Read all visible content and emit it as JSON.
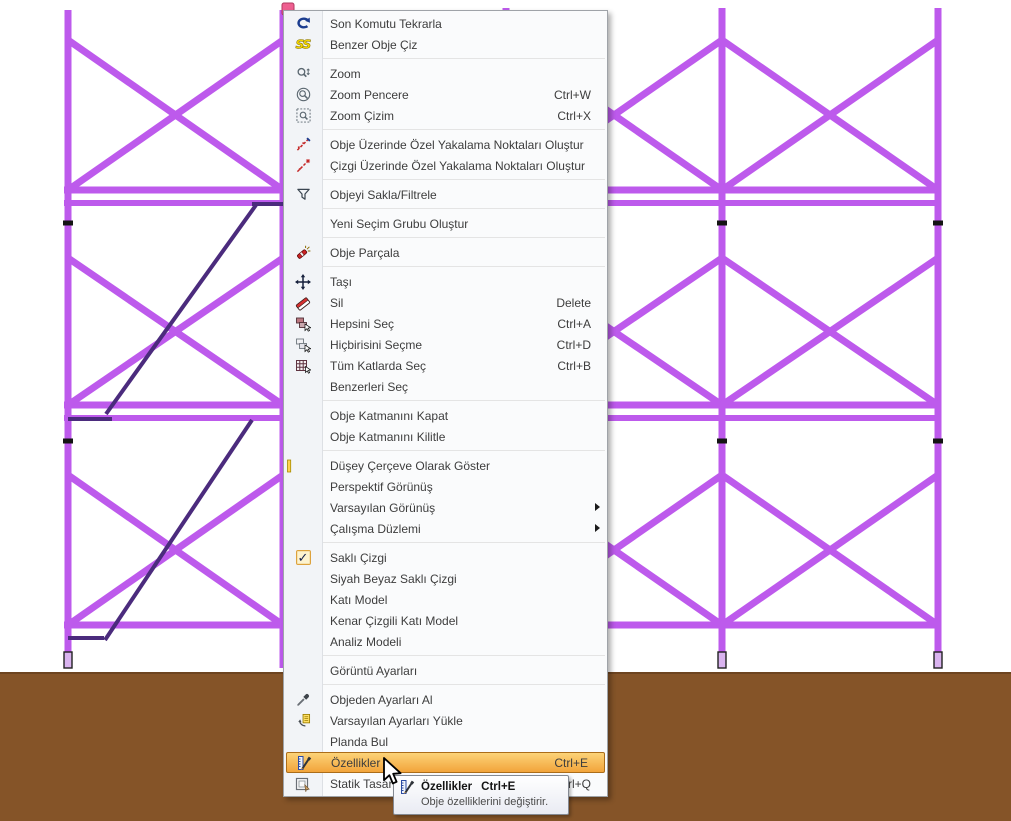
{
  "theme": {
    "scaffold_color": "#bd5aec",
    "stair_color": "#4b2b7d",
    "ground_color": "#855428",
    "selection_node_color": "#ee5f90",
    "menu_bg": "#fafbfc",
    "menu_border": "#9fa3a8",
    "gutter_bg": "#f2f4f7",
    "gutter_line": "#dde0e4",
    "separator_color": "#e4e4e4",
    "text_color": "#3d3d3d",
    "highlight_top": "#fcd378",
    "highlight_bottom": "#f2a43b",
    "highlight_border": "#ab6d19",
    "tooltip_border": "#848992",
    "tooltip_bg_top": "#ffffff",
    "tooltip_bg_bottom": "#e9ebf3"
  },
  "menu": {
    "items": [
      {
        "type": "item",
        "name": "repeat-last-command",
        "icon": "redo-icon",
        "label": "Son Komutu Tekrarla"
      },
      {
        "type": "item",
        "name": "draw-similar-object",
        "icon": "draw-similar-icon",
        "label": "Benzer Obje Çiz"
      },
      {
        "type": "sep"
      },
      {
        "type": "item",
        "name": "zoom",
        "icon": "zoom-icon",
        "label": "Zoom"
      },
      {
        "type": "item",
        "name": "zoom-window",
        "icon": "zoom-window-icon",
        "label": "Zoom Pencere",
        "shortcut": "Ctrl+W"
      },
      {
        "type": "item",
        "name": "zoom-drawing",
        "icon": "zoom-drawing-icon",
        "label": "Zoom Çizim",
        "shortcut": "Ctrl+X"
      },
      {
        "type": "sep"
      },
      {
        "type": "item",
        "name": "snap-points-on-object",
        "icon": "snap-object-icon",
        "label": "Obje Üzerinde Özel Yakalama Noktaları Oluştur"
      },
      {
        "type": "item",
        "name": "snap-points-on-line",
        "icon": "snap-line-icon",
        "label": "Çizgi Üzerinde Özel Yakalama Noktaları Oluştur"
      },
      {
        "type": "sep"
      },
      {
        "type": "item",
        "name": "hide-filter-object",
        "icon": "filter-icon",
        "label": "Objeyi Sakla/Filtrele"
      },
      {
        "type": "sep"
      },
      {
        "type": "item",
        "name": "new-selection-group",
        "label": "Yeni Seçim Grubu Oluştur"
      },
      {
        "type": "sep"
      },
      {
        "type": "item",
        "name": "explode-object",
        "icon": "explode-icon",
        "label": "Obje Parçala"
      },
      {
        "type": "sep"
      },
      {
        "type": "item",
        "name": "move",
        "icon": "move-icon",
        "label": "Taşı"
      },
      {
        "type": "item",
        "name": "delete",
        "icon": "erase-icon",
        "label": "Sil",
        "shortcut": "Delete"
      },
      {
        "type": "item",
        "name": "select-all",
        "icon": "select-all-icon",
        "label": "Hepsini Seç",
        "shortcut": "Ctrl+A"
      },
      {
        "type": "item",
        "name": "select-none",
        "icon": "select-none-icon",
        "label": "Hiçbirisini Seçme",
        "shortcut": "Ctrl+D"
      },
      {
        "type": "item",
        "name": "select-all-floors",
        "icon": "select-floors-icon",
        "label": "Tüm Katlarda Seç",
        "shortcut": "Ctrl+B"
      },
      {
        "type": "item",
        "name": "select-similar",
        "label": "Benzerleri Seç"
      },
      {
        "type": "sep"
      },
      {
        "type": "item",
        "name": "close-object-layer",
        "label": "Obje Katmanını Kapat"
      },
      {
        "type": "item",
        "name": "lock-object-layer",
        "label": "Obje Katmanını Kilitle"
      },
      {
        "type": "sep"
      },
      {
        "type": "item",
        "name": "show-vertical-frame",
        "icon": "vertical-frame-icon",
        "label": "Düşey Çerçeve Olarak Göster"
      },
      {
        "type": "item",
        "name": "perspective-view",
        "label": "Perspektif Görünüş"
      },
      {
        "type": "item",
        "name": "default-view",
        "label": "Varsayılan Görünüş",
        "submenu": true
      },
      {
        "type": "item",
        "name": "work-plane",
        "label": "Çalışma Düzlemi",
        "submenu": true
      },
      {
        "type": "sep"
      },
      {
        "type": "item",
        "name": "hidden-line",
        "checkbox": true,
        "label": "Saklı Çizgi"
      },
      {
        "type": "item",
        "name": "bw-hidden-line",
        "label": "Siyah Beyaz Saklı Çizgi"
      },
      {
        "type": "item",
        "name": "solid-model",
        "label": "Katı Model"
      },
      {
        "type": "item",
        "name": "solid-model-edges",
        "label": "Kenar Çizgili Katı Model"
      },
      {
        "type": "item",
        "name": "analysis-model",
        "label": "Analiz Modeli"
      },
      {
        "type": "sep"
      },
      {
        "type": "item",
        "name": "display-settings",
        "label": "Görüntü Ayarları"
      },
      {
        "type": "sep"
      },
      {
        "type": "item",
        "name": "get-settings-from-object",
        "icon": "eyedropper-icon",
        "label": "Objeden Ayarları Al"
      },
      {
        "type": "item",
        "name": "load-default-settings",
        "icon": "load-defaults-icon",
        "label": "Varsayılan Ayarları Yükle"
      },
      {
        "type": "item",
        "name": "find-in-plan",
        "label": "Planda Bul"
      },
      {
        "type": "item",
        "name": "properties",
        "icon": "properties-icon",
        "label": "Özellikler",
        "shortcut": "Ctrl+E",
        "highlighted": true
      },
      {
        "type": "item",
        "name": "static-design",
        "icon": "static-design-icon",
        "label": "Statik Tasarım",
        "shortcut": "Ctrl+Q"
      }
    ]
  },
  "tooltip": {
    "title": "Özellikler",
    "shortcut": "Ctrl+E",
    "description": "Obje özelliklerini değiştirir.",
    "icon": "properties-icon"
  }
}
